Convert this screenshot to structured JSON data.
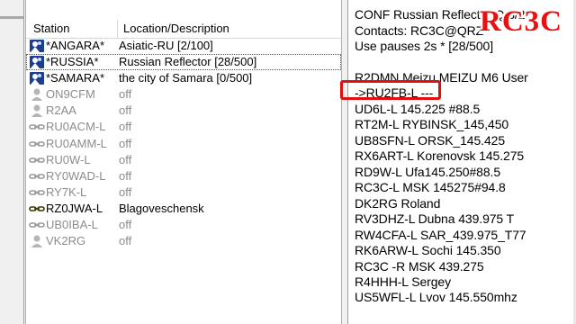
{
  "stations_table": {
    "col_station": "Station",
    "col_location": "Location/Description",
    "rows": [
      {
        "call": "*ANGARA*",
        "loc": "Asiatic-RU [2/100]",
        "status": "online",
        "icon": "conference-icon"
      },
      {
        "call": "*RUSSIA*",
        "loc": "Russian Reflector [28/500]",
        "status": "online",
        "icon": "conference-icon",
        "selected": true
      },
      {
        "call": "*SAMARA*",
        "loc": "the city of Samara [0/500]",
        "status": "online",
        "icon": "conference-icon"
      },
      {
        "call": "ON9CFM",
        "loc": "off",
        "status": "offline",
        "icon": "user-icon"
      },
      {
        "call": "R2AA",
        "loc": "off",
        "status": "offline",
        "icon": "user-icon"
      },
      {
        "call": "RU0ACM-L",
        "loc": "off",
        "status": "offline",
        "icon": "link-icon"
      },
      {
        "call": "RU0AMM-L",
        "loc": "off",
        "status": "offline",
        "icon": "link-icon"
      },
      {
        "call": "RU0W-L",
        "loc": "off",
        "status": "offline",
        "icon": "link-icon"
      },
      {
        "call": "RY0WAD-L",
        "loc": "off",
        "status": "offline",
        "icon": "link-icon"
      },
      {
        "call": "RY7K-L",
        "loc": "off",
        "status": "offline",
        "icon": "link-icon"
      },
      {
        "call": "RZ0JWA-L",
        "loc": "Blagoveschensk",
        "status": "online",
        "icon": "link-icon"
      },
      {
        "call": "UB0IBA-L",
        "loc": "off",
        "status": "offline",
        "icon": "link-icon"
      },
      {
        "call": "VK2RG",
        "loc": "off",
        "status": "offline",
        "icon": "user-icon"
      }
    ]
  },
  "log": {
    "lines": [
      "CONF Russian Reflector  Q 3/2",
      "Contacts: RC3C@QRZ",
      "Use pauses 2s * [28/500]",
      "",
      "R2DMN Meizu MEIZU M6 User",
      "->RU2FB-L ---",
      "UD6L-L 145.225  #88.5",
      "RT2M-L RYBINSK_145,450",
      "UB8SFN-L ORSK_145.425",
      "RX6ART-L Korenovsk 145.275",
      "RD9W-L Ufa145.250#88.5",
      "RC3C-L MSK 145275#94.8",
      "DK2RG Roland",
      "RV3DHZ-L Dubna 439.975 T",
      "RW4CFA-L SAR_439.975_T77",
      "RK6ARW-L Sochi 145.350",
      "RC3C -R MSK 439.275",
      "R4HHH-L Sergey",
      "US5WFL-L Lvov 145.550mhz"
    ]
  },
  "watermark": "RC3C",
  "colors": {
    "online_text": "#000000",
    "offline_text": "#8c8c8c",
    "highlight": "#e01010",
    "watermark": "#e81010"
  }
}
